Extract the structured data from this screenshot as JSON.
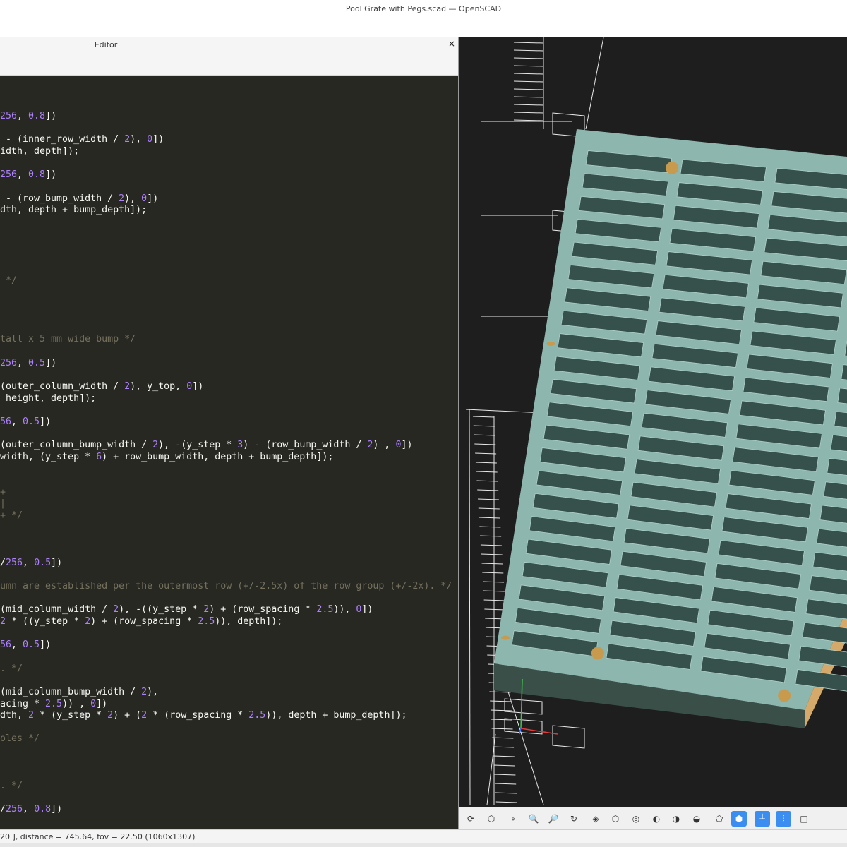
{
  "window": {
    "title": "Pool Grate with Pegs.scad — OpenSCAD"
  },
  "editor": {
    "title": "Editor",
    "close_glyph": "×",
    "lines": [
      [
        {
          "t": "256",
          "k": "n"
        },
        {
          "t": ", "
        },
        {
          "t": "0.8",
          "k": "n"
        },
        {
          "t": "])"
        }
      ],
      [],
      [
        {
          "t": " - (inner_row_width / "
        },
        {
          "t": "2",
          "k": "n"
        },
        {
          "t": "), "
        },
        {
          "t": "0",
          "k": "n"
        },
        {
          "t": "])"
        }
      ],
      [
        {
          "t": "idth, depth]);"
        }
      ],
      [],
      [
        {
          "t": "256",
          "k": "n"
        },
        {
          "t": ", "
        },
        {
          "t": "0.8",
          "k": "n"
        },
        {
          "t": "])"
        }
      ],
      [],
      [
        {
          "t": " - (row_bump_width / "
        },
        {
          "t": "2",
          "k": "n"
        },
        {
          "t": "), "
        },
        {
          "t": "0",
          "k": "n"
        },
        {
          "t": "])"
        }
      ],
      [
        {
          "t": "dth, depth + bump_depth]);"
        }
      ],
      [],
      [],
      [],
      [],
      [],
      [
        {
          "t": " */",
          "k": "c"
        }
      ],
      [],
      [],
      [],
      [],
      [
        {
          "t": "tall x 5 mm wide bump */",
          "k": "c"
        }
      ],
      [],
      [
        {
          "t": "256",
          "k": "n"
        },
        {
          "t": ", "
        },
        {
          "t": "0.5",
          "k": "n"
        },
        {
          "t": "])"
        }
      ],
      [],
      [
        {
          "t": "(outer_column_width / "
        },
        {
          "t": "2",
          "k": "n"
        },
        {
          "t": "), y_top, "
        },
        {
          "t": "0",
          "k": "n"
        },
        {
          "t": "])"
        }
      ],
      [
        {
          "t": " height, depth]);"
        }
      ],
      [],
      [
        {
          "t": "56",
          "k": "n"
        },
        {
          "t": ", "
        },
        {
          "t": "0.5",
          "k": "n"
        },
        {
          "t": "])"
        }
      ],
      [],
      [
        {
          "t": "(outer_column_bump_width / "
        },
        {
          "t": "2",
          "k": "n"
        },
        {
          "t": "), -(y_step * "
        },
        {
          "t": "3",
          "k": "n"
        },
        {
          "t": ") - (row_bump_width / "
        },
        {
          "t": "2",
          "k": "n"
        },
        {
          "t": ") , "
        },
        {
          "t": "0",
          "k": "n"
        },
        {
          "t": "])"
        }
      ],
      [
        {
          "t": "width, (y_step * "
        },
        {
          "t": "6",
          "k": "n"
        },
        {
          "t": ") + row_bump_width, depth + bump_depth]);"
        }
      ],
      [],
      [],
      [
        {
          "t": "+",
          "k": "c"
        }
      ],
      [
        {
          "t": "|",
          "k": "c"
        }
      ],
      [
        {
          "t": "+ */",
          "k": "c"
        }
      ],
      [],
      [],
      [],
      [
        {
          "t": "/"
        },
        {
          "t": "256",
          "k": "n"
        },
        {
          "t": ", "
        },
        {
          "t": "0.5",
          "k": "n"
        },
        {
          "t": "])"
        }
      ],
      [],
      [
        {
          "t": "umn are established per the outermost row (+/-2.5x) of the row group (+/-2x). */",
          "k": "c"
        }
      ],
      [],
      [
        {
          "t": "(mid_column_width / "
        },
        {
          "t": "2",
          "k": "n"
        },
        {
          "t": "), -((y_step * "
        },
        {
          "t": "2",
          "k": "n"
        },
        {
          "t": ") + (row_spacing * "
        },
        {
          "t": "2.5",
          "k": "n"
        },
        {
          "t": ")), "
        },
        {
          "t": "0",
          "k": "n"
        },
        {
          "t": "])"
        }
      ],
      [
        {
          "t": "2",
          "k": "n"
        },
        {
          "t": " * ((y_step * "
        },
        {
          "t": "2",
          "k": "n"
        },
        {
          "t": ") + (row_spacing * "
        },
        {
          "t": "2.5",
          "k": "n"
        },
        {
          "t": ")), depth]);"
        }
      ],
      [],
      [
        {
          "t": "56",
          "k": "n"
        },
        {
          "t": ", "
        },
        {
          "t": "0.5",
          "k": "n"
        },
        {
          "t": "])"
        }
      ],
      [],
      [
        {
          "t": ". */",
          "k": "c"
        }
      ],
      [],
      [
        {
          "t": "(mid_column_bump_width / "
        },
        {
          "t": "2",
          "k": "n"
        },
        {
          "t": "),"
        }
      ],
      [
        {
          "t": "acing * "
        },
        {
          "t": "2.5",
          "k": "n"
        },
        {
          "t": ")) , "
        },
        {
          "t": "0",
          "k": "n"
        },
        {
          "t": "])"
        }
      ],
      [
        {
          "t": "dth, "
        },
        {
          "t": "2",
          "k": "n"
        },
        {
          "t": " * (y_step * "
        },
        {
          "t": "2",
          "k": "n"
        },
        {
          "t": ") + ("
        },
        {
          "t": "2",
          "k": "n"
        },
        {
          "t": " * (row_spacing * "
        },
        {
          "t": "2.5",
          "k": "n"
        },
        {
          "t": ")), depth + bump_depth]);"
        }
      ],
      [],
      [
        {
          "t": "oles */",
          "k": "c"
        }
      ],
      [],
      [],
      [],
      [
        {
          "t": ". */",
          "k": "c"
        }
      ],
      [],
      [
        {
          "t": "/"
        },
        {
          "t": "256",
          "k": "n"
        },
        {
          "t": ", "
        },
        {
          "t": "0.8",
          "k": "n"
        },
        {
          "t": "])"
        }
      ]
    ]
  },
  "viewport": {
    "colors": {
      "background": "#1e1e1e",
      "grate_top": "#8db6ae",
      "grate_slot": "#36504b",
      "grate_side_front": "#3b4f49",
      "grate_side_right": "#d5a96a",
      "peg": "#c89a4e"
    }
  },
  "toolbar": {
    "buttons": [
      {
        "icon": "render-icon",
        "glyph": "⟳"
      },
      {
        "icon": "preview-icon",
        "glyph": "⬡"
      },
      {
        "icon": "view-all-icon",
        "glyph": "⌖"
      },
      {
        "icon": "zoom-in-icon",
        "glyph": "🔍"
      },
      {
        "icon": "zoom-out-icon",
        "glyph": "🔎"
      },
      {
        "icon": "reset-view-icon",
        "glyph": "↻"
      },
      {
        "icon": "view-right-icon",
        "glyph": "◈"
      },
      {
        "icon": "view-top-icon",
        "glyph": "⬡"
      },
      {
        "icon": "view-bottom-icon",
        "glyph": "◎"
      },
      {
        "icon": "view-left-icon",
        "glyph": "◐"
      },
      {
        "icon": "view-front-icon",
        "glyph": "◑"
      },
      {
        "icon": "view-back-icon",
        "glyph": "◒"
      },
      {
        "icon": "diagonal-view-icon",
        "glyph": "⬠"
      },
      {
        "icon": "perspective-icon",
        "glyph": "⬢",
        "active": true
      },
      {
        "icon": "show-axes-icon",
        "glyph": "┴",
        "active": true
      },
      {
        "icon": "show-scale-icon",
        "glyph": "⫶",
        "active": true
      },
      {
        "icon": "show-edges-icon",
        "glyph": "□"
      }
    ]
  },
  "status": {
    "text": "20 ], distance = 745.64, fov = 22.50 (1060x1307)"
  }
}
